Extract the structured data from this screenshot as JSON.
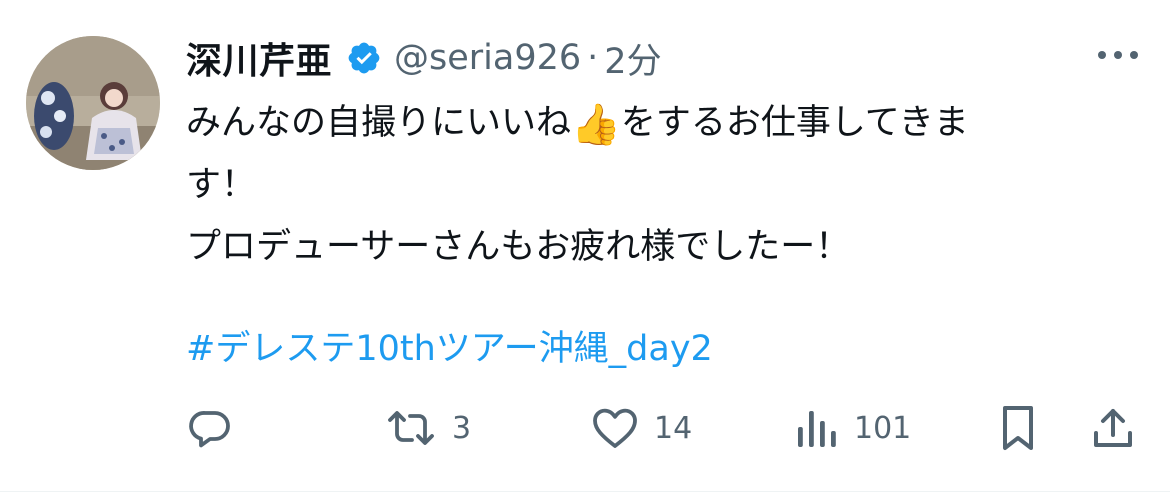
{
  "tweet": {
    "author": {
      "display_name": "深川芹亜",
      "verified_icon": "verified-badge-icon",
      "handle": "@seria926",
      "separator": "·",
      "time": "2分"
    },
    "text": {
      "line1_before_emoji": "みんなの自撮りにいいね",
      "emoji": "👍",
      "line1_after_emoji": "をするお仕事してきま",
      "line2": "す！",
      "line3": "プロデューサーさんもお疲れ様でしたー！"
    },
    "hashtag": "#デレステ10thツアー沖縄_day2",
    "actions": {
      "reply": {
        "icon": "reply-icon",
        "count": ""
      },
      "retweet": {
        "icon": "retweet-icon",
        "count": "3"
      },
      "like": {
        "icon": "heart-icon",
        "count": "14"
      },
      "views": {
        "icon": "views-chart-icon",
        "count": "101"
      },
      "bookmark": {
        "icon": "bookmark-icon"
      },
      "share": {
        "icon": "share-icon"
      }
    },
    "colors": {
      "text": "#0f1419",
      "secondary": "#536471",
      "accent": "#1d9bf0"
    }
  }
}
